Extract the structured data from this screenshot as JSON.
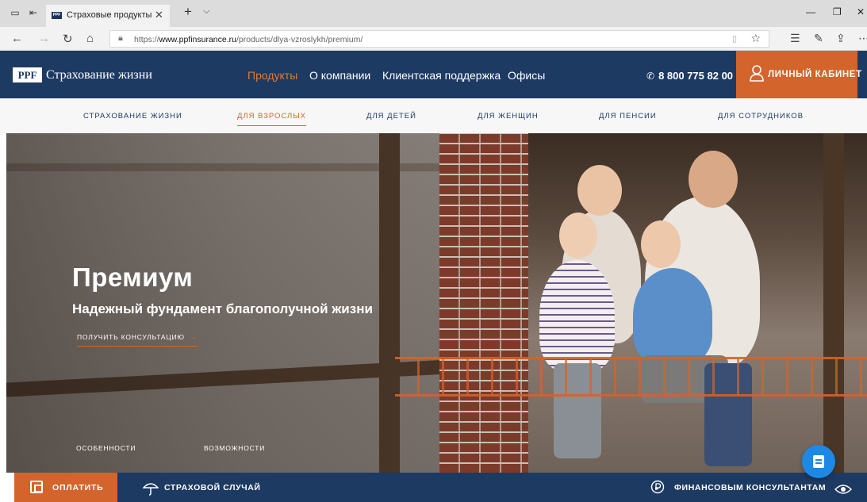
{
  "browser": {
    "tab_title": "Страховые продукты",
    "url_prefix": "https://",
    "url_host": "www.ppfinsurance.ru",
    "url_path": "/products/dlya-vzroslykh/premium/"
  },
  "header": {
    "logo_badge": "PPF",
    "logo_text": "Страхование жизни",
    "nav": [
      "Продукты",
      "О компании",
      "Клиентская поддержка",
      "Офисы"
    ],
    "active_nav": "Продукты",
    "phone": "8 800 775 82 00",
    "cabinet_label": "ЛИЧНЫЙ КАБИНЕТ"
  },
  "subnav": {
    "items": [
      "СТРАХОВАНИЕ ЖИЗНИ",
      "ДЛЯ ВЗРОСЛЫХ",
      "ДЛЯ ДЕТЕЙ",
      "ДЛЯ ЖЕНЩИН",
      "ДЛЯ ПЕНСИИ",
      "ДЛЯ СОТРУДНИКОВ"
    ],
    "active": "ДЛЯ ВЗРОСЛЫХ"
  },
  "hero": {
    "title": "Премиум",
    "subtitle": "Надежный фундамент благополучной жизни",
    "cta": "ПОЛУЧИТЬ КОНСУЛЬТАЦИЮ",
    "links": [
      "ОСОБЕННОСТИ",
      "ВОЗМОЖНОСТИ"
    ]
  },
  "bottom_bar": {
    "pay": "ОПЛАТИТЬ",
    "insurance_case": "СТРАХОВОЙ СЛУЧАЙ",
    "consultants": "ФИНАНСОВЫМ КОНСУЛЬТАНТАМ"
  },
  "colors": {
    "brand_navy": "#1d3a63",
    "brand_orange": "#d2642c",
    "chat_blue": "#1e88e5"
  },
  "icons": [
    "phone-icon",
    "user-icon",
    "wallet-icon",
    "umbrella-icon",
    "ruble-icon",
    "eye-icon",
    "chat-icon"
  ]
}
